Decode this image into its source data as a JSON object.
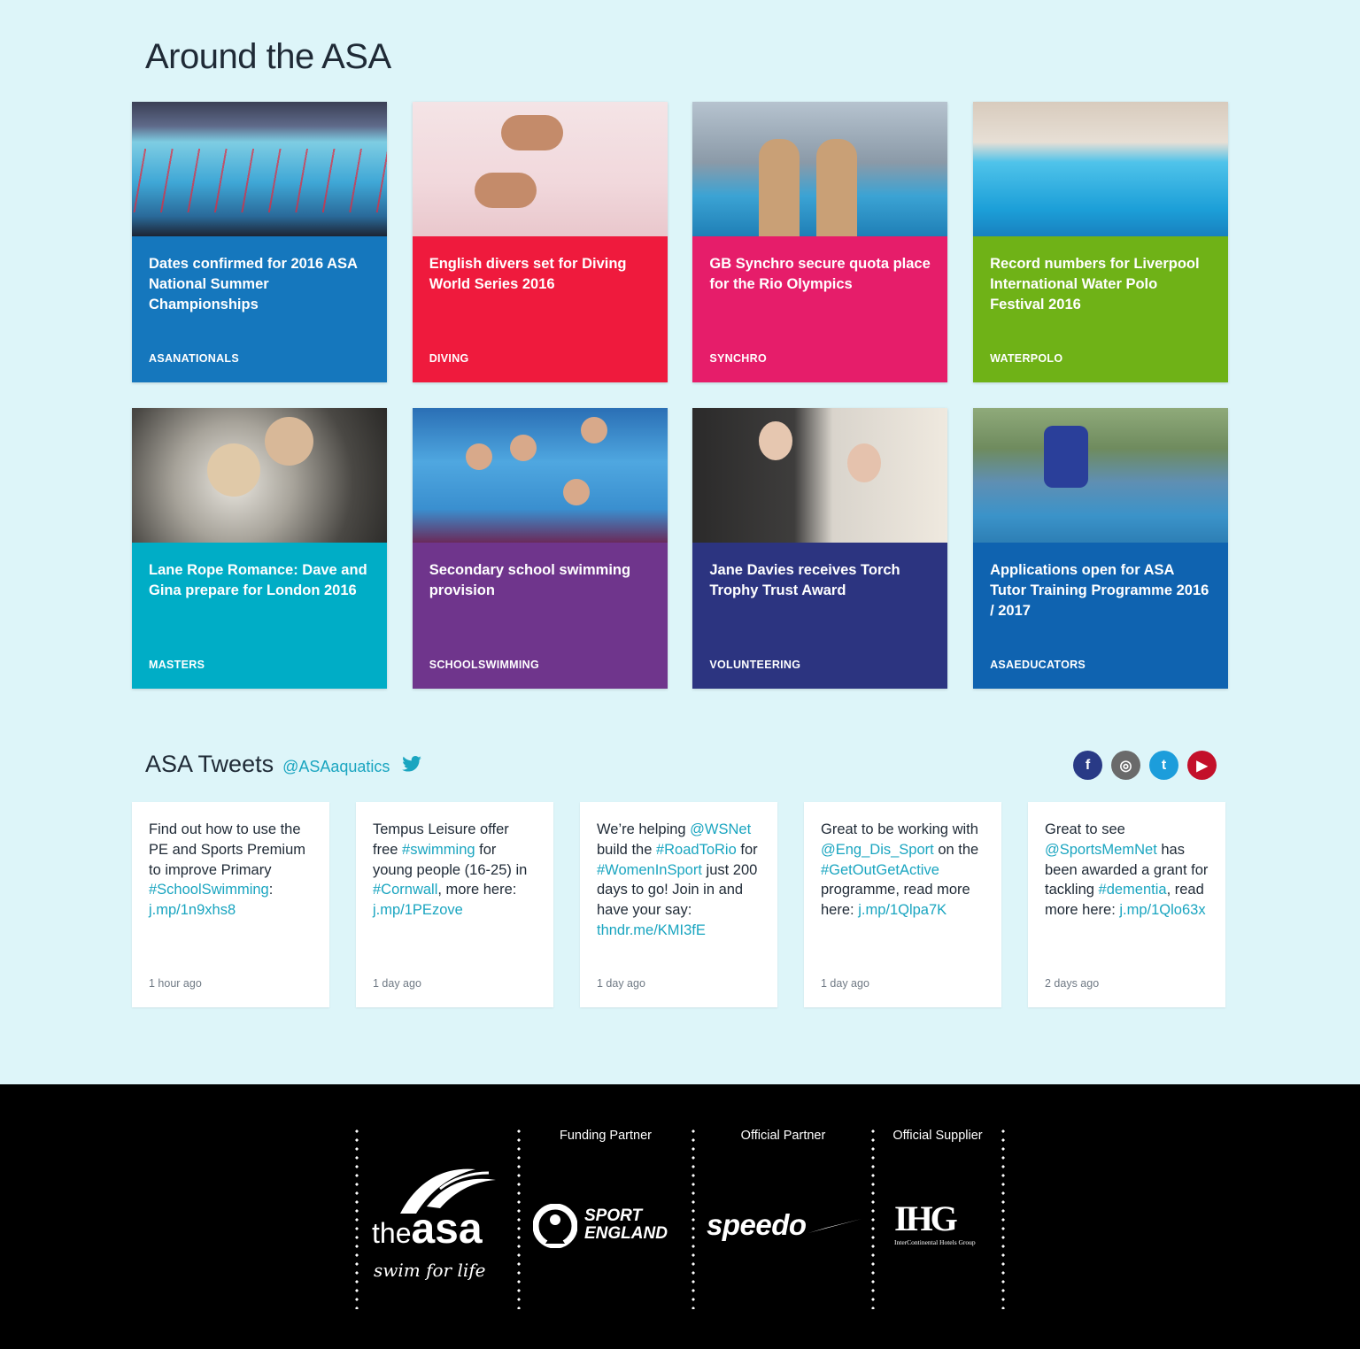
{
  "section_title": "Around the ASA",
  "news": [
    {
      "title": "Dates confirmed for 2016 ASA National Summer Championships",
      "tag": "ASANATIONALS",
      "color": "#1577bd",
      "photo": "ph-pool"
    },
    {
      "title": "English divers set for Diving World Series 2016",
      "tag": "DIVING",
      "color": "#ef1a3d",
      "photo": "ph-dive"
    },
    {
      "title": "GB Synchro secure quota place for the Rio Olympics",
      "tag": "SYNCHRO",
      "color": "#e61d6a",
      "photo": "ph-synchro"
    },
    {
      "title": "Record numbers for Liverpool International Water Polo Festival 2016",
      "tag": "WATERPOLO",
      "color": "#6fb217",
      "photo": "ph-waterpolo"
    },
    {
      "title": "Lane Rope Romance: Dave and Gina prepare for London 2016",
      "tag": "MASTERS",
      "color": "#00adc6",
      "photo": "ph-masters"
    },
    {
      "title": "Secondary school swimming provision",
      "tag": "SCHOOLSWIMMING",
      "color": "#6f358c",
      "photo": "ph-school"
    },
    {
      "title": "Jane Davies receives Torch Trophy Trust Award",
      "tag": "VOLUNTEERING",
      "color": "#2c3480",
      "photo": "ph-volunteer"
    },
    {
      "title": "Applications open for ASA Tutor Training Programme 2016 / 2017",
      "tag": "ASAEDUCATORS",
      "color": "#0f63b0",
      "photo": "ph-tutor"
    }
  ],
  "tweets_section": {
    "title": "ASA Tweets",
    "handle": "@ASAaquatics"
  },
  "social": [
    {
      "name": "facebook",
      "glyph": "f",
      "color": "#293a86"
    },
    {
      "name": "instagram",
      "glyph": "◎",
      "color": "#6a6a6a"
    },
    {
      "name": "twitter",
      "glyph": "t",
      "color": "#1c9ddb"
    },
    {
      "name": "youtube",
      "glyph": "▶",
      "color": "#c3102a"
    }
  ],
  "tweets": [
    {
      "parts": [
        [
          "Find out how to use the PE and Sports Premium to improve Primary ",
          false
        ],
        [
          "#SchoolSwimming",
          true
        ],
        [
          ": ",
          false
        ],
        [
          "j.mp/1n9xhs8",
          true
        ]
      ],
      "time": "1 hour ago"
    },
    {
      "parts": [
        [
          "Tempus Leisure offer free ",
          false
        ],
        [
          "#swimming",
          true
        ],
        [
          " for young people (16-25) in ",
          false
        ],
        [
          "#Cornwall",
          true
        ],
        [
          ", more here: ",
          false
        ],
        [
          "j.mp/1PEzove",
          true
        ]
      ],
      "time": "1 day ago"
    },
    {
      "parts": [
        [
          "We’re helping ",
          false
        ],
        [
          "@WSNet",
          true
        ],
        [
          " build the ",
          false
        ],
        [
          "#RoadToRio",
          true
        ],
        [
          " for ",
          false
        ],
        [
          "#WomenInSport",
          true
        ],
        [
          " just 200 days to go! Join in and have your say: ",
          false
        ],
        [
          "thndr.me/KMI3fE",
          true
        ]
      ],
      "time": "1 day ago"
    },
    {
      "parts": [
        [
          "Great to be working with ",
          false
        ],
        [
          "@Eng_Dis_Sport",
          true
        ],
        [
          " on the ",
          false
        ],
        [
          "#GetOutGetActive",
          true
        ],
        [
          " programme, read more here: ",
          false
        ],
        [
          "j.mp/1Qlpa7K",
          true
        ]
      ],
      "time": "1 day ago"
    },
    {
      "parts": [
        [
          "Great to see ",
          false
        ],
        [
          "@SportsMemNet",
          true
        ],
        [
          " has been awarded a grant for tackling ",
          false
        ],
        [
          "#dementia",
          true
        ],
        [
          ", read more here: ",
          false
        ],
        [
          "j.mp/1Qlo63x",
          true
        ]
      ],
      "time": "2 days ago"
    }
  ],
  "footer": {
    "partners": [
      {
        "label": "Funding Partner",
        "logo": "SPORT ENGLAND"
      },
      {
        "label": "Official Partner",
        "logo": "speedo"
      },
      {
        "label": "Official Supplier",
        "logo": "IHG"
      }
    ],
    "asa_logo": {
      "line1": "the",
      "line2": "asa",
      "tagline": "swim for life"
    },
    "ihg_sub": "InterContinental Hotels Group"
  }
}
